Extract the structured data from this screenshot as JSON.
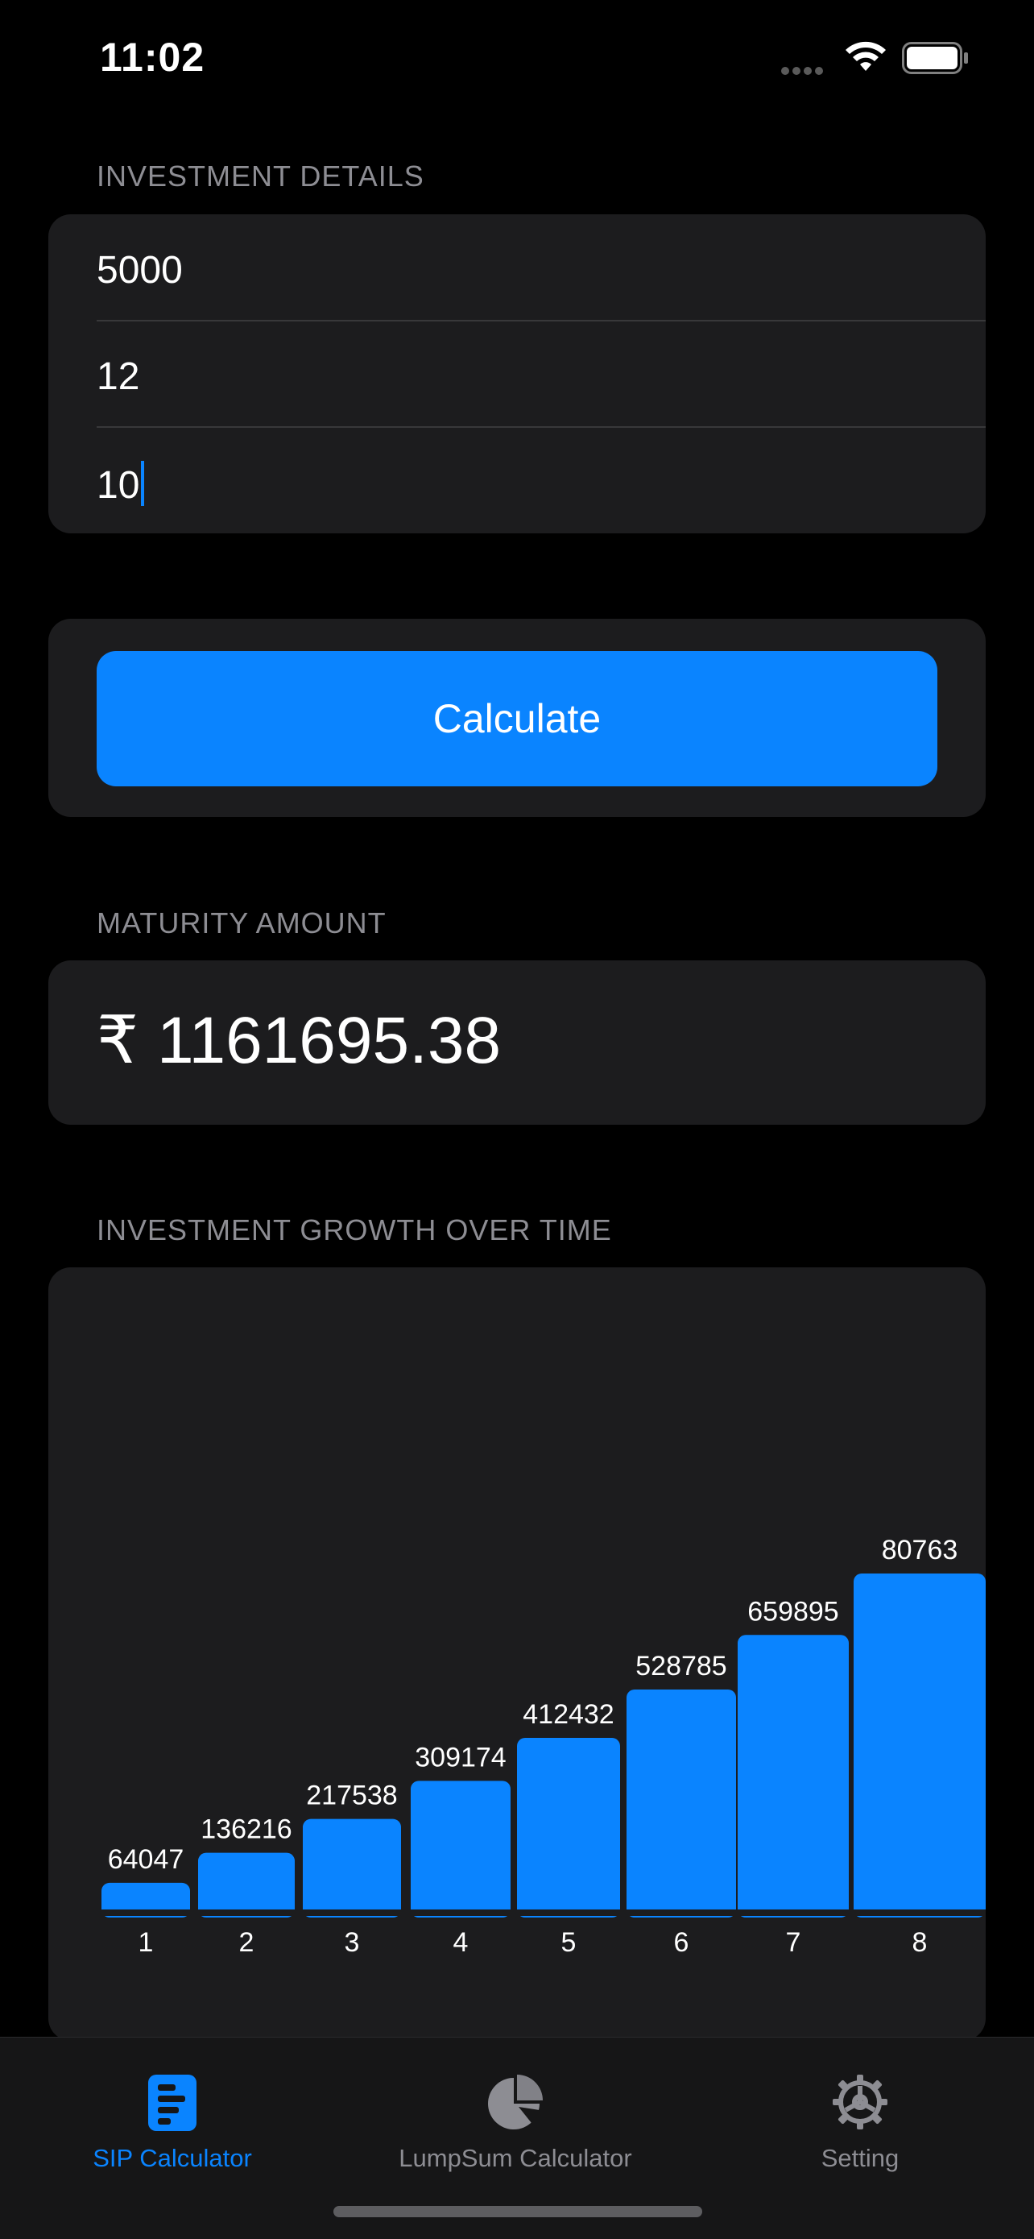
{
  "status_bar": {
    "time": "11:02"
  },
  "investment_details": {
    "header": "INVESTMENT DETAILS",
    "fields": [
      {
        "value": "5000"
      },
      {
        "value": "12"
      },
      {
        "value": "10"
      }
    ]
  },
  "calculate": {
    "label": "Calculate"
  },
  "maturity": {
    "header": "MATURITY AMOUNT",
    "amount": "₹ 1161695.38"
  },
  "growth": {
    "header": "INVESTMENT GROWTH OVER TIME"
  },
  "chart_data": {
    "type": "bar",
    "categories": [
      "1",
      "2",
      "3",
      "4",
      "5",
      "6",
      "7",
      "8"
    ],
    "values": [
      64047,
      136216,
      217538,
      309174,
      412432,
      528785,
      659895,
      807630
    ],
    "value_labels": [
      "64047",
      "136216",
      "217538",
      "309174",
      "412432",
      "528785",
      "659895",
      "80763"
    ],
    "bar_color": "#0a84ff",
    "title": "",
    "xlabel": "",
    "ylabel": "",
    "grid": false
  },
  "tab_bar": {
    "tabs": [
      {
        "label": "SIP Calculator",
        "icon": "sip-calculator-icon",
        "active": true
      },
      {
        "label": "LumpSum Calculator",
        "icon": "pie-chart-icon",
        "active": false
      },
      {
        "label": "Setting",
        "icon": "gear-icon",
        "active": false
      }
    ]
  },
  "colors": {
    "accent": "#0a84ff",
    "card": "#1c1c1e",
    "background": "#000000"
  }
}
